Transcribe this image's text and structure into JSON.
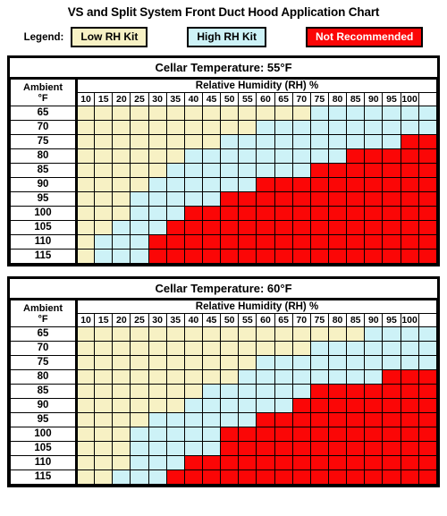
{
  "title": "VS and Split System Front Duct Hood Application Chart",
  "legend": {
    "label": "Legend:",
    "items": [
      {
        "text": "Low RH Kit",
        "color": "#f7f1c4",
        "text_color": "#000000"
      },
      {
        "text": "High RH Kit",
        "color": "#cdf2f7",
        "text_color": "#000000"
      },
      {
        "text": "Not Recommended",
        "color": "#fb0606",
        "text_color": "#ffffff"
      }
    ]
  },
  "columns_header": "Relative Humidity (RH) %",
  "ambient_header_line1": "Ambient",
  "ambient_header_line2": "°F",
  "chart_data": {
    "type": "heatmap",
    "title": "VS and Split System Front Duct Hood Application Chart",
    "xlabel": "Relative Humidity (RH) %",
    "ylabel": "Ambient °F",
    "categories": [
      "10",
      "15",
      "20",
      "25",
      "30",
      "35",
      "40",
      "45",
      "50",
      "55",
      "60",
      "65",
      "70",
      "75",
      "80",
      "85",
      "90",
      "95",
      "100"
    ],
    "legend_position": "top",
    "value_legend": {
      "L": "Low RH Kit",
      "H": "High RH Kit",
      "N": "Not Recommended"
    },
    "tables": [
      {
        "title": "Cellar Temperature: 55°F",
        "rows": [
          {
            "ambient": "65",
            "cells": [
              "L",
              "L",
              "L",
              "L",
              "L",
              "L",
              "L",
              "L",
              "L",
              "L",
              "L",
              "L",
              "L",
              "H",
              "H",
              "H",
              "H",
              "H",
              "H",
              "H"
            ]
          },
          {
            "ambient": "70",
            "cells": [
              "L",
              "L",
              "L",
              "L",
              "L",
              "L",
              "L",
              "L",
              "L",
              "L",
              "H",
              "H",
              "H",
              "H",
              "H",
              "H",
              "H",
              "H",
              "H",
              "H"
            ]
          },
          {
            "ambient": "75",
            "cells": [
              "L",
              "L",
              "L",
              "L",
              "L",
              "L",
              "L",
              "L",
              "H",
              "H",
              "H",
              "H",
              "H",
              "H",
              "H",
              "H",
              "H",
              "H",
              "N",
              "N"
            ]
          },
          {
            "ambient": "80",
            "cells": [
              "L",
              "L",
              "L",
              "L",
              "L",
              "L",
              "H",
              "H",
              "H",
              "H",
              "H",
              "H",
              "H",
              "H",
              "H",
              "N",
              "N",
              "N",
              "N",
              "N"
            ]
          },
          {
            "ambient": "85",
            "cells": [
              "L",
              "L",
              "L",
              "L",
              "L",
              "H",
              "H",
              "H",
              "H",
              "H",
              "H",
              "H",
              "H",
              "N",
              "N",
              "N",
              "N",
              "N",
              "N",
              "N"
            ]
          },
          {
            "ambient": "90",
            "cells": [
              "L",
              "L",
              "L",
              "L",
              "H",
              "H",
              "H",
              "H",
              "H",
              "H",
              "N",
              "N",
              "N",
              "N",
              "N",
              "N",
              "N",
              "N",
              "N",
              "N"
            ]
          },
          {
            "ambient": "95",
            "cells": [
              "L",
              "L",
              "L",
              "H",
              "H",
              "H",
              "H",
              "H",
              "N",
              "N",
              "N",
              "N",
              "N",
              "N",
              "N",
              "N",
              "N",
              "N",
              "N",
              "N"
            ]
          },
          {
            "ambient": "100",
            "cells": [
              "L",
              "L",
              "L",
              "H",
              "H",
              "H",
              "N",
              "N",
              "N",
              "N",
              "N",
              "N",
              "N",
              "N",
              "N",
              "N",
              "N",
              "N",
              "N",
              "N"
            ]
          },
          {
            "ambient": "105",
            "cells": [
              "L",
              "L",
              "H",
              "H",
              "H",
              "N",
              "N",
              "N",
              "N",
              "N",
              "N",
              "N",
              "N",
              "N",
              "N",
              "N",
              "N",
              "N",
              "N",
              "N"
            ]
          },
          {
            "ambient": "110",
            "cells": [
              "L",
              "H",
              "H",
              "H",
              "N",
              "N",
              "N",
              "N",
              "N",
              "N",
              "N",
              "N",
              "N",
              "N",
              "N",
              "N",
              "N",
              "N",
              "N",
              "N"
            ]
          },
          {
            "ambient": "115",
            "cells": [
              "L",
              "H",
              "H",
              "H",
              "N",
              "N",
              "N",
              "N",
              "N",
              "N",
              "N",
              "N",
              "N",
              "N",
              "N",
              "N",
              "N",
              "N",
              "N",
              "N"
            ]
          }
        ]
      },
      {
        "title": "Cellar Temperature: 60°F",
        "rows": [
          {
            "ambient": "65",
            "cells": [
              "L",
              "L",
              "L",
              "L",
              "L",
              "L",
              "L",
              "L",
              "L",
              "L",
              "L",
              "L",
              "L",
              "L",
              "L",
              "L",
              "H",
              "H",
              "H",
              "H"
            ]
          },
          {
            "ambient": "70",
            "cells": [
              "L",
              "L",
              "L",
              "L",
              "L",
              "L",
              "L",
              "L",
              "L",
              "L",
              "L",
              "L",
              "L",
              "H",
              "H",
              "H",
              "H",
              "H",
              "H",
              "H"
            ]
          },
          {
            "ambient": "75",
            "cells": [
              "L",
              "L",
              "L",
              "L",
              "L",
              "L",
              "L",
              "L",
              "L",
              "L",
              "H",
              "H",
              "H",
              "H",
              "H",
              "H",
              "H",
              "H",
              "H",
              "H"
            ]
          },
          {
            "ambient": "80",
            "cells": [
              "L",
              "L",
              "L",
              "L",
              "L",
              "L",
              "L",
              "L",
              "L",
              "H",
              "H",
              "H",
              "H",
              "H",
              "H",
              "H",
              "H",
              "N",
              "N",
              "N"
            ]
          },
          {
            "ambient": "85",
            "cells": [
              "L",
              "L",
              "L",
              "L",
              "L",
              "L",
              "L",
              "H",
              "H",
              "H",
              "H",
              "H",
              "H",
              "N",
              "N",
              "N",
              "N",
              "N",
              "N",
              "N"
            ]
          },
          {
            "ambient": "90",
            "cells": [
              "L",
              "L",
              "L",
              "L",
              "L",
              "L",
              "H",
              "H",
              "H",
              "H",
              "H",
              "H",
              "N",
              "N",
              "N",
              "N",
              "N",
              "N",
              "N",
              "N"
            ]
          },
          {
            "ambient": "95",
            "cells": [
              "L",
              "L",
              "L",
              "L",
              "H",
              "H",
              "H",
              "H",
              "H",
              "H",
              "N",
              "N",
              "N",
              "N",
              "N",
              "N",
              "N",
              "N",
              "N",
              "N"
            ]
          },
          {
            "ambient": "100",
            "cells": [
              "L",
              "L",
              "L",
              "H",
              "H",
              "H",
              "H",
              "H",
              "N",
              "N",
              "N",
              "N",
              "N",
              "N",
              "N",
              "N",
              "N",
              "N",
              "N",
              "N"
            ]
          },
          {
            "ambient": "105",
            "cells": [
              "L",
              "L",
              "L",
              "H",
              "H",
              "H",
              "H",
              "H",
              "N",
              "N",
              "N",
              "N",
              "N",
              "N",
              "N",
              "N",
              "N",
              "N",
              "N",
              "N"
            ]
          },
          {
            "ambient": "110",
            "cells": [
              "L",
              "L",
              "L",
              "H",
              "H",
              "H",
              "N",
              "N",
              "N",
              "N",
              "N",
              "N",
              "N",
              "N",
              "N",
              "N",
              "N",
              "N",
              "N",
              "N"
            ]
          },
          {
            "ambient": "115",
            "cells": [
              "L",
              "L",
              "H",
              "H",
              "H",
              "N",
              "N",
              "N",
              "N",
              "N",
              "N",
              "N",
              "N",
              "N",
              "N",
              "N",
              "N",
              "N",
              "N",
              "N"
            ]
          }
        ]
      }
    ]
  }
}
